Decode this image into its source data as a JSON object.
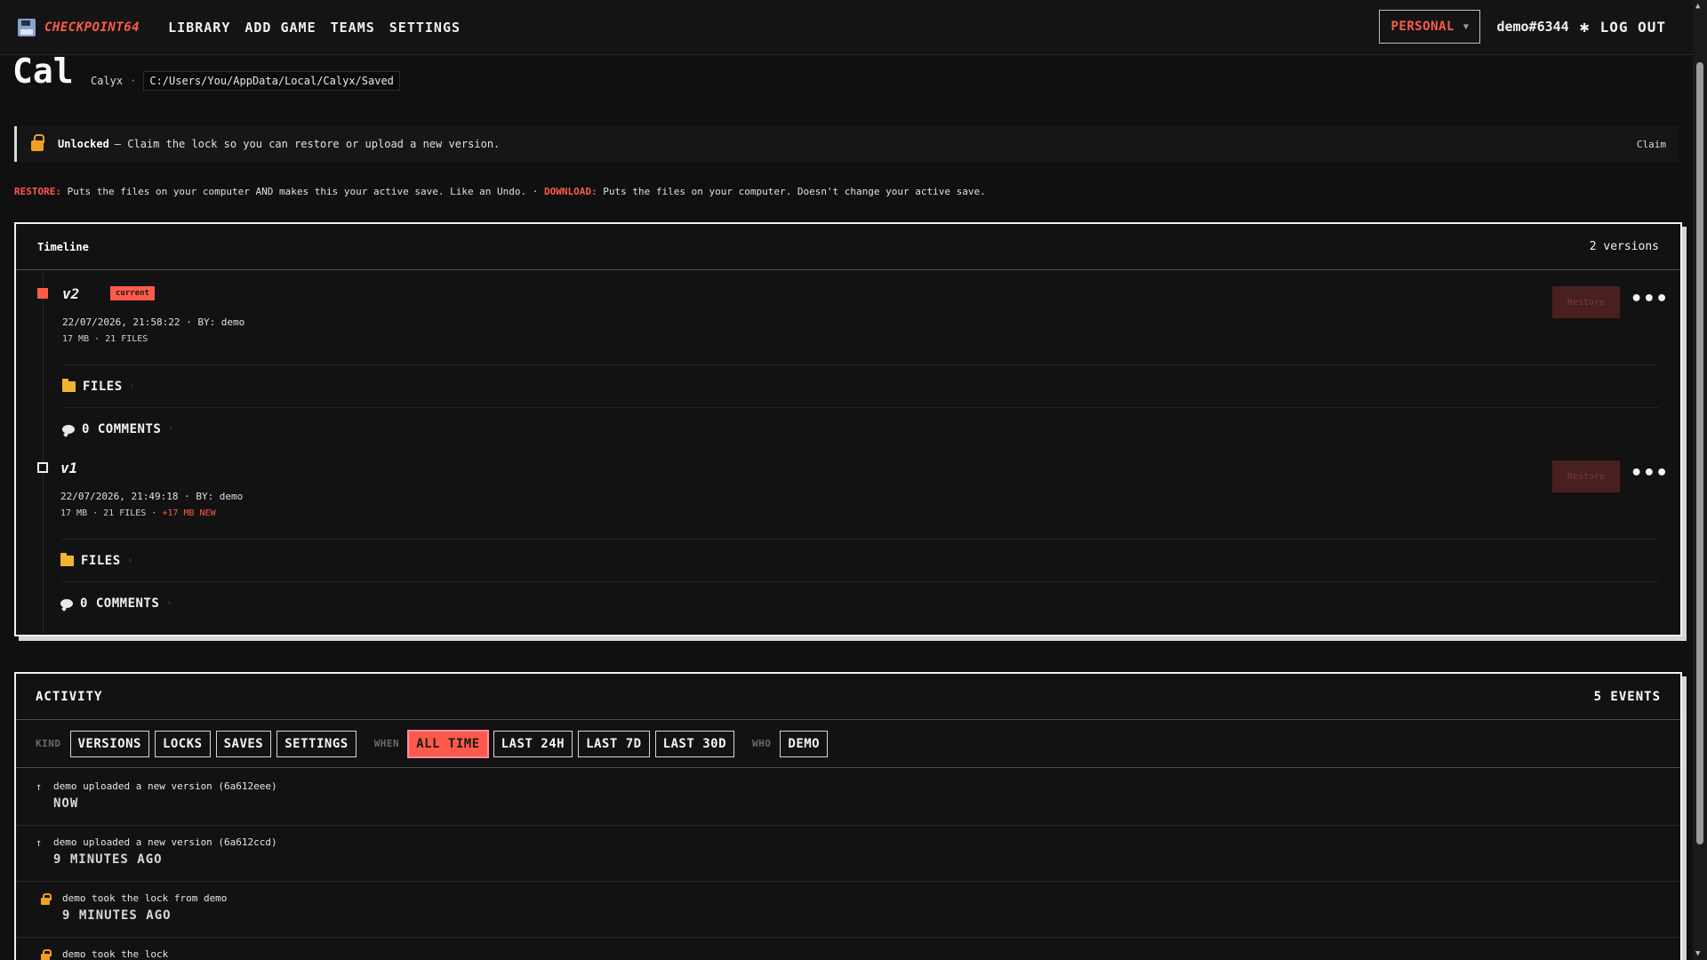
{
  "app": {
    "brand": "CHECKPOINT64",
    "nav": [
      "LIBRARY",
      "ADD GAME",
      "TEAMS",
      "SETTINGS"
    ],
    "workspace": "PERSONAL",
    "username": "demo#6344",
    "logout": "LOG OUT"
  },
  "game": {
    "title": "Cal",
    "name": "Calyx",
    "path": "C:/Users/You/AppData/Local/Calyx/Saved"
  },
  "lock": {
    "status": "Unlocked",
    "message": "— Claim the lock so you can restore or upload a new version.",
    "claim": "Claim"
  },
  "help": {
    "restore_kw": "RESTORE:",
    "restore_text": " Puts the files on your computer AND makes this your active save. Like an Undo. · ",
    "download_kw": "DOWNLOAD:",
    "download_text": " Puts the files on your computer. Doesn't change your active save."
  },
  "timeline": {
    "title": "Timeline",
    "count": "2 versions",
    "versions": [
      {
        "name": "v2",
        "badge": "current",
        "meta": "22/07/2026, 21:58:22 · BY: demo",
        "stats": "17 MB · 21 FILES",
        "new": "",
        "restore": "Restore",
        "files": "FILES",
        "comments": "0 COMMENTS"
      },
      {
        "name": "v1",
        "badge": "",
        "meta": "22/07/2026, 21:49:18 · BY: demo",
        "stats": "17 MB · 21 FILES · ",
        "new": "+17 MB NEW",
        "restore": "Restore",
        "files": "FILES",
        "comments": "0 COMMENTS"
      }
    ]
  },
  "activity": {
    "title": "ACTIVITY",
    "count": "5 EVENTS",
    "filters": {
      "kind_label": "KIND",
      "kind": [
        "VERSIONS",
        "LOCKS",
        "SAVES",
        "SETTINGS"
      ],
      "when_label": "WHEN",
      "when": [
        "ALL TIME",
        "LAST 24H",
        "LAST 7D",
        "LAST 30D"
      ],
      "when_active": "ALL TIME",
      "who_label": "WHO",
      "who": [
        "DEMO"
      ]
    },
    "events": [
      {
        "icon": "upload-icon",
        "text": "demo uploaded a new version (6a612eee)",
        "time": "NOW"
      },
      {
        "icon": "upload-icon",
        "text": "demo uploaded a new version (6a612ccd)",
        "time": "9 MINUTES AGO"
      },
      {
        "icon": "lock-icon",
        "text": "demo took the lock from demo",
        "time": "9 MINUTES AGO"
      },
      {
        "icon": "lock-icon",
        "text": "demo took the lock",
        "time": ""
      }
    ]
  },
  "colors": {
    "accent": "#ff5a4a",
    "background": "#101010"
  }
}
